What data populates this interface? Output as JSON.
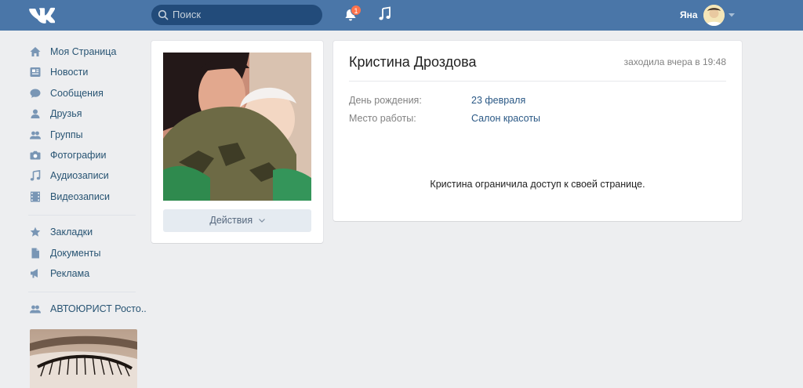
{
  "header": {
    "search_placeholder": "Поиск",
    "notifications_count": "1",
    "user_name": "Яна"
  },
  "sidebar": {
    "items": [
      {
        "label": "Моя Страница",
        "icon": "home-icon"
      },
      {
        "label": "Новости",
        "icon": "news-icon"
      },
      {
        "label": "Сообщения",
        "icon": "messages-icon"
      },
      {
        "label": "Друзья",
        "icon": "friend-icon"
      },
      {
        "label": "Группы",
        "icon": "groups-icon"
      },
      {
        "label": "Фотографии",
        "icon": "camera-icon"
      },
      {
        "label": "Аудиозаписи",
        "icon": "music-icon"
      },
      {
        "label": "Видеозаписи",
        "icon": "video-icon"
      }
    ],
    "items2": [
      {
        "label": "Закладки",
        "icon": "star-icon"
      },
      {
        "label": "Документы",
        "icon": "document-icon"
      },
      {
        "label": "Реклама",
        "icon": "megaphone-icon"
      }
    ],
    "items3": [
      {
        "label": "АВТОЮРИСТ Росто..",
        "icon": "groups-icon"
      }
    ]
  },
  "profile": {
    "actions_label": "Действия",
    "name": "Кристина Дроздова",
    "last_seen": "заходила вчера в 19:48",
    "fields": [
      {
        "key": "День рождения:",
        "value": "23 февраля"
      },
      {
        "key": "Место работы:",
        "value": "Салон красоты"
      }
    ],
    "closed_message": "Кристина ограничила доступ к своей странице."
  },
  "colors": {
    "header": "#4a76a8",
    "link": "#2a5885",
    "background": "#edeef0"
  }
}
